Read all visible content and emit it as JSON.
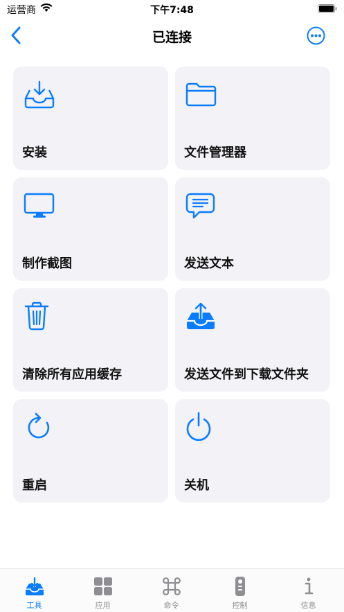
{
  "status_bar": {
    "carrier": "运营商",
    "time": "下午7:48"
  },
  "nav": {
    "title": "已连接"
  },
  "colors": {
    "accent": "#0a7cff",
    "tile_bg": "#f2f2f7",
    "tab_inactive": "#8e8e93"
  },
  "tiles": [
    {
      "label": "安装",
      "icon": "install-tray-icon"
    },
    {
      "label": "文件管理器",
      "icon": "folder-icon"
    },
    {
      "label": "制作截图",
      "icon": "display-icon"
    },
    {
      "label": "发送文本",
      "icon": "message-bubble-icon"
    },
    {
      "label": "清除所有应用缓存",
      "icon": "trash-icon"
    },
    {
      "label": "发送文件到下载文件夹",
      "icon": "upload-tray-icon"
    },
    {
      "label": "重启",
      "icon": "restart-icon"
    },
    {
      "label": "关机",
      "icon": "power-icon"
    }
  ],
  "tabs": [
    {
      "label": "工具",
      "icon": "tools-tray-icon",
      "active": true
    },
    {
      "label": "应用",
      "icon": "apps-grid-icon",
      "active": false
    },
    {
      "label": "命令",
      "icon": "command-icon",
      "active": false
    },
    {
      "label": "控制",
      "icon": "remote-icon",
      "active": false
    },
    {
      "label": "信息",
      "icon": "info-icon",
      "active": false
    }
  ]
}
